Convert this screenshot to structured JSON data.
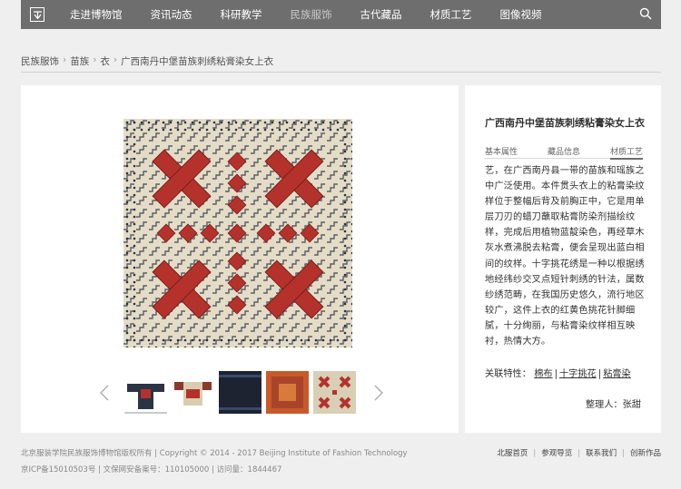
{
  "nav": {
    "items": [
      {
        "label": "走进博物馆"
      },
      {
        "label": "资讯动态"
      },
      {
        "label": "科研教学"
      },
      {
        "label": "民族服饰"
      },
      {
        "label": "古代藏品"
      },
      {
        "label": "材质工艺"
      },
      {
        "label": "图像视频"
      }
    ],
    "active_index": 3,
    "logo_icon": "museum-logo-icon",
    "search_icon": "search-icon"
  },
  "breadcrumb": {
    "items": [
      "民族服饰",
      "苗族",
      "衣",
      "广西南丹中堡苗族刺绣粘膏染女上衣"
    ],
    "separator": "›"
  },
  "gallery": {
    "main_image_icon": "embroidered-textile-image",
    "thumbnails": [
      "thumb-jacket-front",
      "thumb-jacket-back",
      "thumb-dark-panel",
      "thumb-orange-panel",
      "thumb-cross-panel"
    ],
    "prev_icon": "chevron-left-icon",
    "next_icon": "chevron-right-icon"
  },
  "detail": {
    "title": "广西南丹中堡苗族刺绣粘膏染女上衣",
    "tabs": [
      {
        "label": "基本属性"
      },
      {
        "label": "藏品信息"
      },
      {
        "label": "材质工艺"
      }
    ],
    "active_tab": 2,
    "description": "艺，在广西南丹县一带的苗族和瑶族之中广泛使用。本件贯头衣上的粘膏染纹样位于整幅后背及前胸正中，它是用单层刀刃的蜡刀蘸取粘膏防染剂描绘纹样，完成后用植物蓝靛染色，再经草木灰水煮沸脱去粘膏，便会呈现出蓝白相间的纹样。十字挑花绣是一种以根据绣地经纬纱交叉点短针刺绣的针法，属数纱绣范畴，在我国历史悠久，流行地区较广，这件上衣的红黄色挑花针脚细腻，十分绚丽，与粘膏染纹样相互映衬，热情大方。",
    "related_label": "关联特性：",
    "related_links": [
      "棉布",
      "十字挑花",
      "粘膏染"
    ],
    "editor": "整理人：张甜"
  },
  "footer": {
    "line1": "北京服装学院民族服饰博物馆版权所有 | Copyright © 2014 - 2017 Beijing Institute of Fashion Technology",
    "line2": "京ICP备15010503号 | 文保网安备案号：110105000 | 访问量：1844467",
    "links": [
      "北服首页",
      "参观导览",
      "联系我们",
      "创新作品"
    ]
  },
  "colors": {
    "nav_bg": "#6e6e6e",
    "page_bg": "#efefef",
    "textile_red": "#b5322c",
    "textile_beige": "#e4dcc6",
    "indigo": "#2b3445"
  }
}
